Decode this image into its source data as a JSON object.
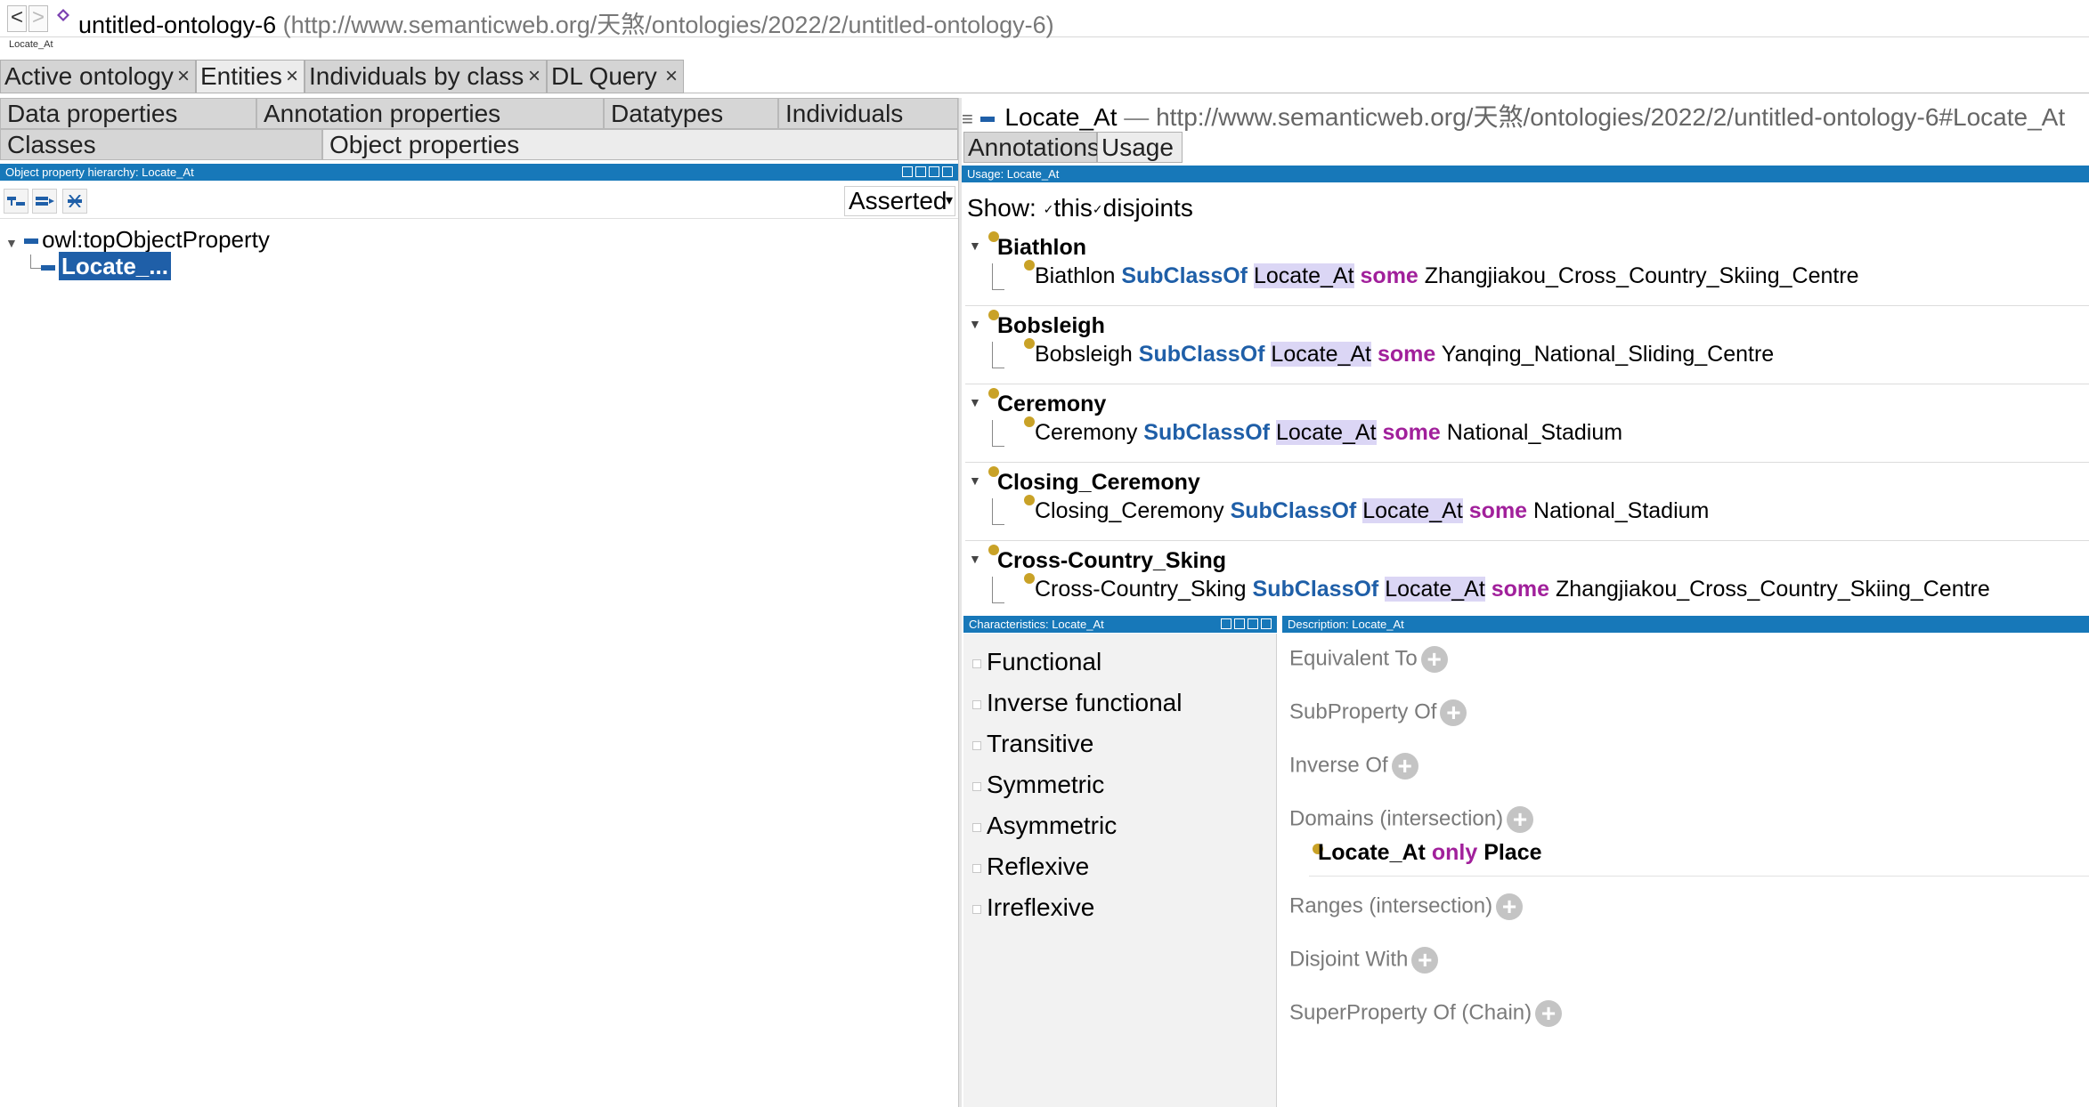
{
  "titlebar": {
    "back": "<",
    "forward": ">",
    "ontology_name": "untitled-ontology-6",
    "ontology_url": "(http://www.semanticweb.org/天煞/ontologies/2022/2/untitled-ontology-6)",
    "breadcrumb": "Locate_At"
  },
  "top_tabs": [
    {
      "label": "Active ontology",
      "close": "×"
    },
    {
      "label": "Entities",
      "close": "×"
    },
    {
      "label": "Individuals by class",
      "close": "×"
    },
    {
      "label": "DL Query",
      "close": "×"
    }
  ],
  "left": {
    "tabs_row1": [
      "Data properties",
      "Annotation properties",
      "Datatypes",
      "Individuals"
    ],
    "tabs_row2": [
      "Classes",
      "Object properties"
    ],
    "view_title": "Object property hierarchy: Locate_At",
    "asserted": "Asserted",
    "tree": {
      "root": "owl:topObjectProperty",
      "child": "Locate_..."
    }
  },
  "right": {
    "entity_name": "Locate_At",
    "dash": "—",
    "entity_iri": "http://www.semanticweb.org/天煞/ontologies/2022/2/untitled-ontology-6#Locate_At",
    "tabs": [
      "Annotations",
      "Usage"
    ],
    "usage_view_title": "Usage: Locate_At",
    "show_label": "Show:",
    "show_this": "this",
    "show_disjoints": "disjoints",
    "usage": [
      {
        "head": "Biathlon",
        "subject": "Biathlon",
        "subclass": "SubClassOf",
        "prop": "Locate_At",
        "some": "some",
        "filler": "Zhangjiakou_Cross_Country_Skiing_Centre"
      },
      {
        "head": "Bobsleigh",
        "subject": "Bobsleigh",
        "subclass": "SubClassOf",
        "prop": "Locate_At",
        "some": "some",
        "filler": "Yanqing_National_Sliding_Centre"
      },
      {
        "head": "Ceremony",
        "subject": "Ceremony",
        "subclass": "SubClassOf",
        "prop": "Locate_At",
        "some": "some",
        "filler": "National_Stadium"
      },
      {
        "head": "Closing_Ceremony",
        "subject": "Closing_Ceremony",
        "subclass": "SubClassOf",
        "prop": "Locate_At",
        "some": "some",
        "filler": "National_Stadium"
      },
      {
        "head": "Cross-Country_Sking",
        "subject": "Cross-Country_Sking",
        "subclass": "SubClassOf",
        "prop": "Locate_At",
        "some": "some",
        "filler": "Zhangjiakou_Cross_Country_Skiing_Centre"
      }
    ],
    "characteristics_title": "Characteristics: Locate_At",
    "characteristics": [
      "Functional",
      "Inverse functional",
      "Transitive",
      "Symmetric",
      "Asymmetric",
      "Reflexive",
      "Irreflexive"
    ],
    "description_title": "Description: Locate_At",
    "description": {
      "equivalent": "Equivalent To",
      "subproperty": "SubProperty Of",
      "inverse": "Inverse Of",
      "domains": "Domains (intersection)",
      "domain_item": {
        "prop": "Locate_At",
        "only": "only",
        "cls": "Place"
      },
      "ranges": "Ranges (intersection)",
      "disjoint": "Disjoint With",
      "superproperty": "SuperProperty Of (Chain)",
      "plus": "+"
    }
  },
  "colors": {
    "view_bar": "#1778b9",
    "keyword_blue": "#1f5fa8",
    "keyword_purple": "#a1209b",
    "bullet": "#c9a227",
    "highlight": "#dbd6f5"
  }
}
